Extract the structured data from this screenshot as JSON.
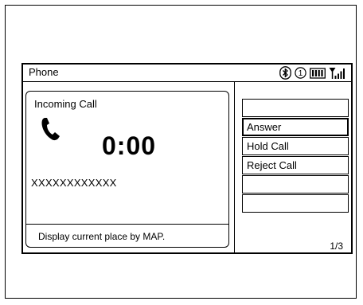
{
  "header": {
    "title": "Phone",
    "status_icons": [
      "bluetooth-icon",
      "numbered-indicator-icon",
      "battery-icon",
      "signal-strength-icon"
    ],
    "indicator_number": "1"
  },
  "call": {
    "status": "Incoming Call",
    "timer": "0:00",
    "caller_number": "XXXXXXXXXXXX",
    "footer": "Display current place by MAP."
  },
  "menu": {
    "items": [
      {
        "label": ""
      },
      {
        "label": "Answer",
        "selected": true
      },
      {
        "label": "Hold Call"
      },
      {
        "label": "Reject Call"
      },
      {
        "label": ""
      },
      {
        "label": ""
      }
    ],
    "page_indicator": "1/3"
  }
}
